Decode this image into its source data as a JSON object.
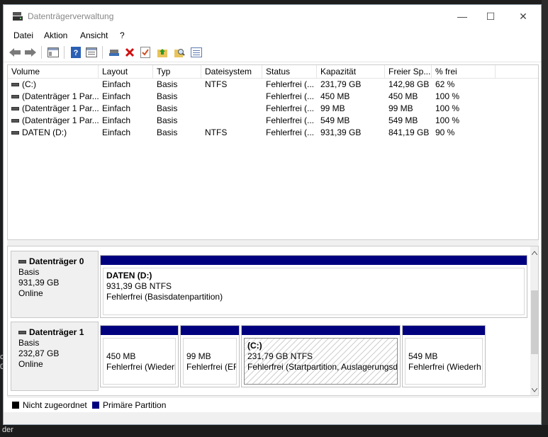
{
  "window": {
    "title": "Datenträgerverwaltung",
    "controls": {
      "minimize": "—",
      "maximize": "☐",
      "close": "✕"
    }
  },
  "menu": [
    "Datei",
    "Aktion",
    "Ansicht",
    "?"
  ],
  "toolbar": [
    "back-icon",
    "forward-icon",
    "show-hide-console-tree-icon",
    "help-icon",
    "properties-icon",
    "connect-icon",
    "delete-icon",
    "check-icon",
    "folder-up-icon",
    "search-folder-icon",
    "list-view-icon"
  ],
  "volumes": {
    "columns": [
      "Volume",
      "Layout",
      "Typ",
      "Dateisystem",
      "Status",
      "Kapazität",
      "Freier Sp...",
      "% frei"
    ],
    "rows": [
      [
        "(C:)",
        "Einfach",
        "Basis",
        "NTFS",
        "Fehlerfrei (...",
        "231,79 GB",
        "142,98 GB",
        "62 %"
      ],
      [
        "(Datenträger 1 Par...",
        "Einfach",
        "Basis",
        "",
        "Fehlerfrei (...",
        "450 MB",
        "450 MB",
        "100 %"
      ],
      [
        "(Datenträger 1 Par...",
        "Einfach",
        "Basis",
        "",
        "Fehlerfrei (...",
        "99 MB",
        "99 MB",
        "100 %"
      ],
      [
        "(Datenträger 1 Par...",
        "Einfach",
        "Basis",
        "",
        "Fehlerfrei (...",
        "549 MB",
        "549 MB",
        "100 %"
      ],
      [
        "DATEN (D:)",
        "Einfach",
        "Basis",
        "NTFS",
        "Fehlerfrei (...",
        "931,39 GB",
        "841,19 GB",
        "90 %"
      ]
    ]
  },
  "disks": [
    {
      "name": "Datenträger 0",
      "type": "Basis",
      "size": "931,39 GB",
      "state": "Online",
      "partitions": [
        {
          "title": "DATEN  (D:)",
          "line1": "931,39 GB NTFS",
          "line2": "Fehlerfrei (Basisdatenpartition)"
        }
      ]
    },
    {
      "name": "Datenträger 1",
      "type": "Basis",
      "size": "232,87 GB",
      "state": "Online",
      "partitions": [
        {
          "title": "",
          "line1": "450 MB",
          "line2": "Fehlerfrei (Wiederh"
        },
        {
          "title": "",
          "line1": "99 MB",
          "line2": "Fehlerfrei (EF"
        },
        {
          "title": "(C:)",
          "line1": "231,79 GB NTFS",
          "line2": "Fehlerfrei (Startpartition, Auslagerungsda"
        },
        {
          "title": "",
          "line1": "549 MB",
          "line2": "Fehlerfrei (Wiederh"
        }
      ]
    }
  ],
  "legend": [
    {
      "label": "Nicht zugeordnet",
      "color": "#000000"
    },
    {
      "label": "Primäre Partition",
      "color": "#00007f"
    }
  ],
  "colors": {
    "primary_partition": "#00007f"
  },
  "desktop": {
    "left_fragment_1": "c",
    "left_fragment_2": "02",
    "bottom_fragment": "der"
  }
}
